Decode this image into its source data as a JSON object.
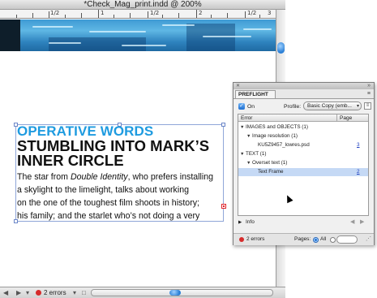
{
  "window": {
    "title": "*Check_Mag_print.indd @ 200%"
  },
  "ruler": {
    "labels": [
      "1/2",
      "1",
      "1/2",
      "2",
      "1/2",
      "3"
    ]
  },
  "article": {
    "kicker": "OPERATIVE WORDS",
    "headline_1": "STUMBLING INTO MARK’S",
    "headline_2": "INNER CIRCLE",
    "body": [
      {
        "pre": "The star from ",
        "em": "Double Identity",
        "post": ", who prefers installing"
      },
      {
        "pre": "a skylight to the limelight, talks about working",
        "em": "",
        "post": ""
      },
      {
        "pre": "on the one of the toughest film shoots in history;",
        "em": "",
        "post": ""
      },
      {
        "pre": "his family; and the starlet who’s not doing a very",
        "em": "",
        "post": ""
      }
    ]
  },
  "statusbar": {
    "errors": "2 errors"
  },
  "preflight": {
    "tab": "PREFLIGHT",
    "on_label": "On",
    "profile_label": "Profile:",
    "profile_value": "Basic Copy (emb...",
    "columns": {
      "error": "Error",
      "page": "Page"
    },
    "rows": [
      {
        "label": "IMAGES and OBJECTS (1)",
        "page": ""
      },
      {
        "label": "Image resolution (1)",
        "page": ""
      },
      {
        "label": "KU5Z9457_lowres.psd",
        "page": "3"
      },
      {
        "label": "TEXT (1)",
        "page": ""
      },
      {
        "label": "Overset text (1)",
        "page": ""
      },
      {
        "label": "Text Frame",
        "page": "2"
      }
    ],
    "info_label": "Info",
    "footer": {
      "errors": "2 errors",
      "pages_label": "Pages:",
      "all_label": "All"
    }
  },
  "icons": [
    "close-icon",
    "panel-menu-icon",
    "checkbox-checked-icon",
    "profile-menu-icon",
    "disclosure-triangle-icon",
    "error-dot-icon",
    "arrow-left-icon",
    "arrow-right-icon",
    "radio-on-icon",
    "radio-off-icon"
  ],
  "colors": {
    "kicker": "#1e9be0",
    "error_dot": "#d62b2b",
    "selection": "#c5d9f5",
    "accent": "#2a7fd6"
  }
}
